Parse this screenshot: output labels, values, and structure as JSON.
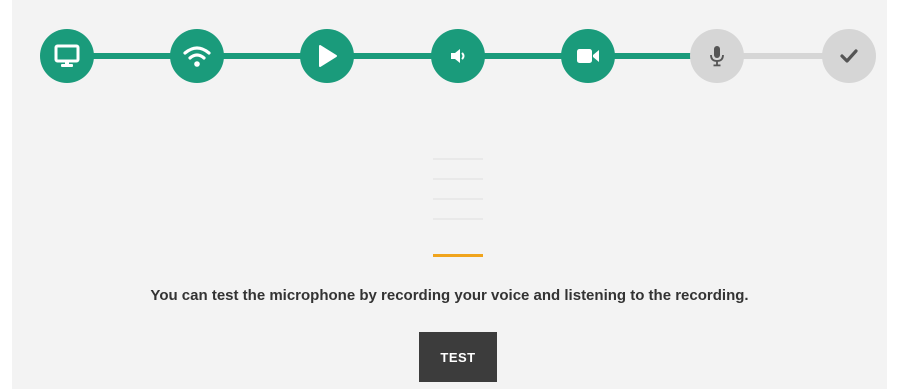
{
  "colors": {
    "accent": "#1a9b7b",
    "pending": "#d6d6d6",
    "pending_icon": "#555555",
    "meter_active": "#f0a41c",
    "meter_inactive": "#e9e9e9",
    "button_bg": "#3c3c3c"
  },
  "steps": [
    {
      "icon": "monitor-icon",
      "status": "done"
    },
    {
      "icon": "wifi-icon",
      "status": "done"
    },
    {
      "icon": "play-icon",
      "status": "done"
    },
    {
      "icon": "speaker-icon",
      "status": "done"
    },
    {
      "icon": "video-camera-icon",
      "status": "done"
    },
    {
      "icon": "microphone-icon",
      "status": "pending"
    },
    {
      "icon": "checkmark-icon",
      "status": "pending"
    }
  ],
  "meter": {
    "bars_total": 5,
    "bars_active": 1
  },
  "message": "You can test the microphone by recording your voice and listening to the recording.",
  "test_button_label": "TEST"
}
